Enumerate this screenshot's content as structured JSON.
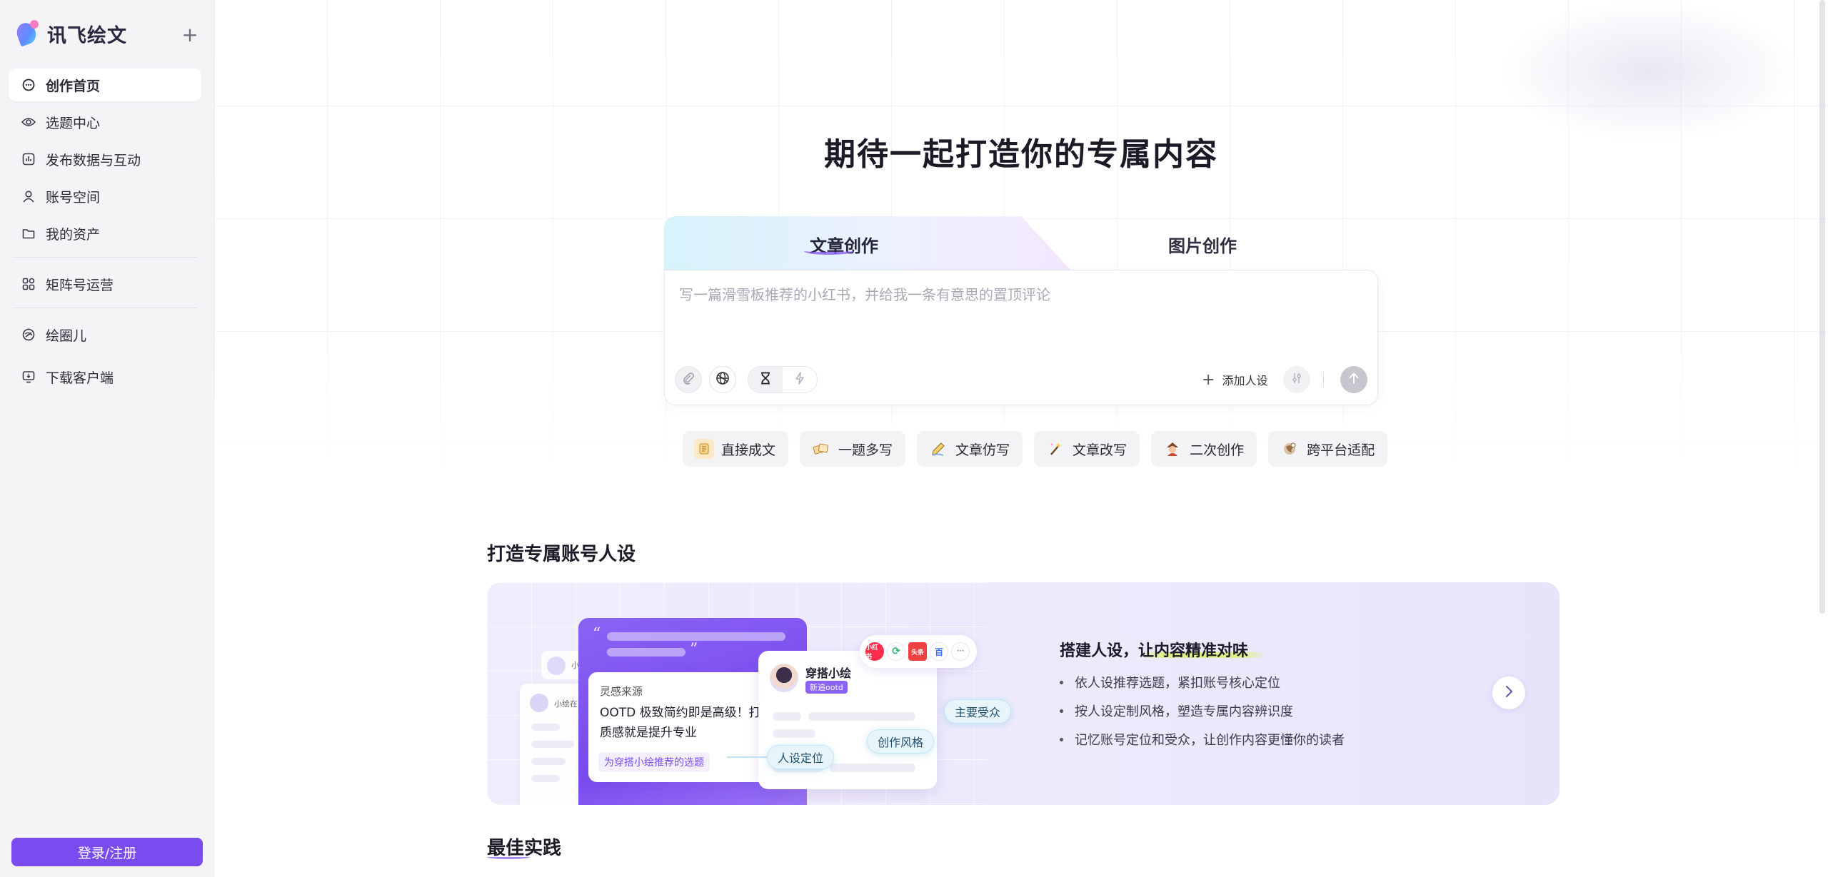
{
  "brand": {
    "name": "讯飞绘文"
  },
  "sidebar": {
    "new_label": "+",
    "items": [
      {
        "label": "创作首页",
        "icon": "chat-bubble-icon",
        "active": true
      },
      {
        "label": "选题中心",
        "icon": "eye-icon"
      },
      {
        "label": "发布数据与互动",
        "icon": "bar-chart-icon"
      },
      {
        "label": "账号空间",
        "icon": "user-icon"
      },
      {
        "label": "我的资产",
        "icon": "folder-icon"
      },
      {
        "label": "矩阵号运营",
        "icon": "grid-icon"
      },
      {
        "label": "绘圈儿",
        "icon": "circle-link-icon"
      },
      {
        "label": "下载客户端",
        "icon": "monitor-download-icon"
      }
    ],
    "login_label": "登录/注册"
  },
  "hero": {
    "title": "期待一起打造你的专属内容",
    "tabs": [
      {
        "label": "文章创作",
        "active": true
      },
      {
        "label": "图片创作",
        "active": false
      }
    ],
    "composer": {
      "placeholder": "写一篇滑雪板推荐的小红书，并给我一条有意思的置顶评论",
      "add_persona_label": "添加人设"
    },
    "chips": [
      {
        "label": "直接成文",
        "icon": "scroll-icon"
      },
      {
        "label": "一题多写",
        "icon": "papers-icon"
      },
      {
        "label": "文章仿写",
        "icon": "pen-icon"
      },
      {
        "label": "文章改写",
        "icon": "wand-icon"
      },
      {
        "label": "二次创作",
        "icon": "character-icon"
      },
      {
        "label": "跨平台适配",
        "icon": "globe-icon"
      }
    ]
  },
  "persona_section": {
    "title": "打造专属账号人设",
    "illustration": {
      "mini_label_1": "小",
      "mini_label_2": "小绘在",
      "source_label": "灵感来源",
      "card_text_line1": "OOTD 极致简约即是高级！打",
      "card_text_line2": "质感就是提升专业",
      "card_tag": "为穿搭小绘推荐的选题",
      "profile_name": "穿搭小绘",
      "profile_badge": "新追ootd",
      "platform_icons": [
        "小红书",
        "⟳",
        "头条",
        "百",
        "···"
      ],
      "pill_audience": "主要受众",
      "pill_style": "创作风格",
      "pill_position": "人设定位"
    },
    "banner_title": "搭建人设，让内容精准对味",
    "bullets": [
      "依人设推荐选题，紧扣账号核心定位",
      "按人设定制风格，塑造专属内容辨识度",
      "记忆账号定位和受众，让创作内容更懂你的读者"
    ]
  },
  "best_practice": {
    "title": "最佳实践"
  },
  "colors": {
    "accent": "#7a4cf0",
    "sidebar_bg": "#f4f4f7"
  }
}
